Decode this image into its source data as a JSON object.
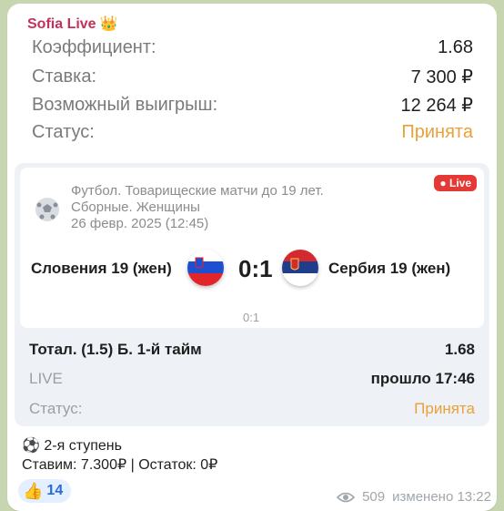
{
  "message": {
    "sender": "Sofia Live",
    "sender_icon": "crown-icon",
    "info": [
      {
        "label": "Коэффициент:",
        "value": "1.68"
      },
      {
        "label": "Ставка:",
        "value": "7 300 ₽"
      },
      {
        "label": "Возможный выигрыш:",
        "value": "12 264 ₽"
      },
      {
        "label": "Статус:",
        "value": "Принята"
      }
    ],
    "match": {
      "sport_icon": "soccer-ball-icon",
      "league_line1": "Футбол. Товарищеские матчи до 19 лет.",
      "league_line2": "Сборные. Женщины",
      "date": "26 февр. 2025 (12:45)",
      "live_badge": "Live",
      "team_home": "Словения 19 (жен)",
      "team_away": "Сербия 19 (жен)",
      "score": "0:1",
      "subscore": "0:1"
    },
    "bet": {
      "market": "Тотал. (1.5) Б. 1-й тайм",
      "odds": "1.68",
      "live_label": "LIVE",
      "elapsed": "прошло 17:46",
      "status_label": "Статус:",
      "status_value": "Принята"
    },
    "footer_line1": "2-я ступень",
    "footer_line2": "Ставим: 7.300₽ | Остаток: 0₽",
    "reaction_count": "14",
    "views": "509",
    "edited": "изменено 13:22",
    "colors": {
      "sender": "#c2325a",
      "accepted": "#e9a13a",
      "live": "#e53935"
    }
  }
}
